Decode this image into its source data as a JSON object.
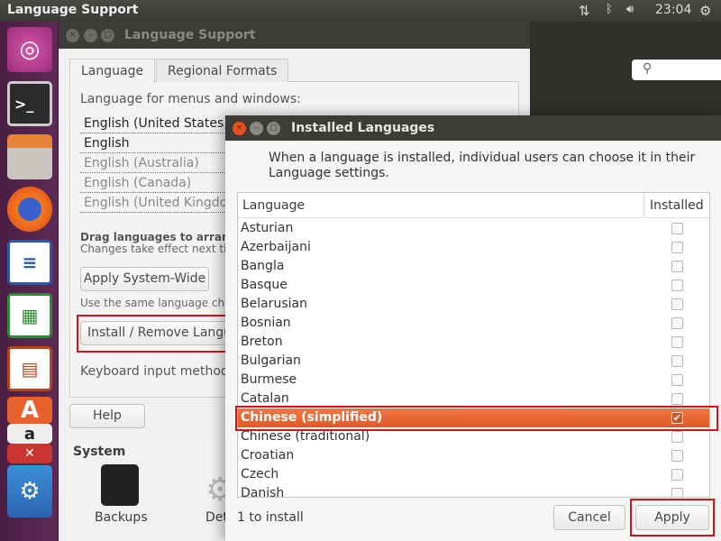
{
  "top_panel": {
    "title": "Language Support",
    "time": "23:04",
    "icons": [
      "network-icon",
      "bluetooth-icon",
      "volume-icon",
      "power-gear-icon"
    ]
  },
  "launcher": {
    "items": [
      "ubuntu-dash-icon",
      "terminal-icon",
      "file-cabinet-icon",
      "firefox-icon",
      "writer-icon",
      "calc-icon",
      "impress-icon",
      "software-center-icon",
      "amazon-icon",
      "settings-icon",
      "system-settings-icon"
    ]
  },
  "background": {
    "system_heading": "System",
    "backups_label": "Backups",
    "details_label": "Det"
  },
  "language_support": {
    "title": "Language Support",
    "tabs": [
      "Language",
      "Regional Formats"
    ],
    "list_label": "Language for menus and windows:",
    "languages": [
      "English (United States)",
      "English",
      "English (Australia)",
      "English (Canada)",
      "English (United Kingdom)"
    ],
    "drag_hint": "Drag languages to arrange t",
    "changes_hint": "Changes take effect next tim",
    "apply_system_wide": "Apply System-Wide",
    "same_choice_hint": "Use the same language choic",
    "install_remove": "Install / Remove Langu",
    "keyboard_label": "Keyboard input method",
    "help": "Help"
  },
  "installed_languages": {
    "title": "Installed Languages",
    "description": "When a language is installed, individual users can choose it in their Language settings.",
    "columns": [
      "Language",
      "Installed"
    ],
    "rows": [
      {
        "name": "Asturian",
        "installed": false
      },
      {
        "name": "Azerbaijani",
        "installed": false
      },
      {
        "name": "Bangla",
        "installed": false
      },
      {
        "name": "Basque",
        "installed": false
      },
      {
        "name": "Belarusian",
        "installed": false
      },
      {
        "name": "Bosnian",
        "installed": false
      },
      {
        "name": "Breton",
        "installed": false
      },
      {
        "name": "Bulgarian",
        "installed": false
      },
      {
        "name": "Burmese",
        "installed": false
      },
      {
        "name": "Catalan",
        "installed": false
      },
      {
        "name": "Chinese (simplified)",
        "installed": true,
        "selected": true
      },
      {
        "name": "Chinese (traditional)",
        "installed": false
      },
      {
        "name": "Croatian",
        "installed": false
      },
      {
        "name": "Czech",
        "installed": false
      },
      {
        "name": "Danish",
        "installed": false
      }
    ],
    "status": "1 to install",
    "cancel": "Cancel",
    "apply": "Apply",
    "accent": "#e95420"
  }
}
